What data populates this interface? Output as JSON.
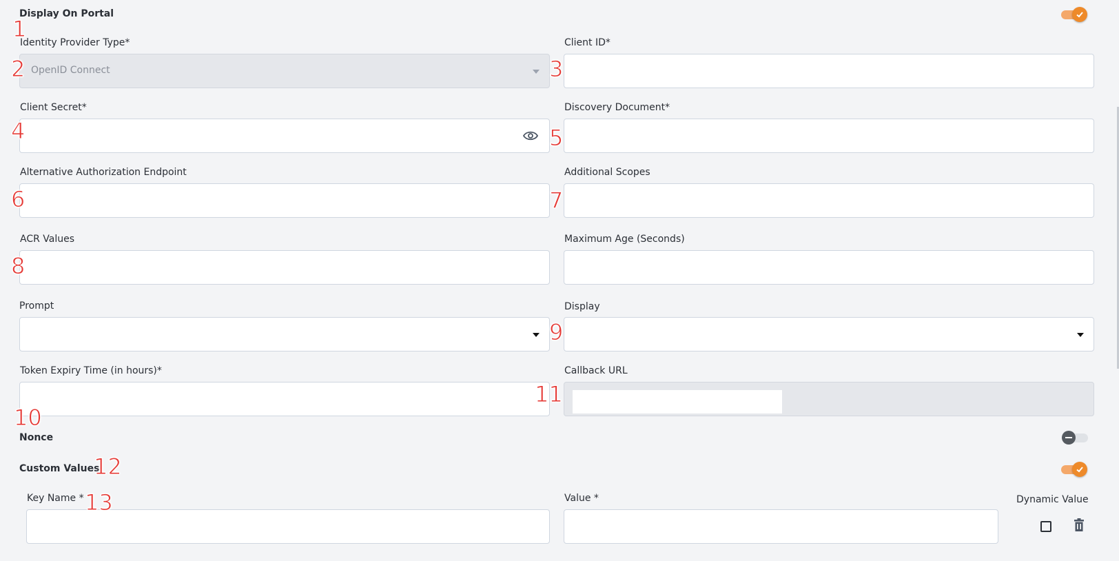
{
  "display_on_portal": {
    "label": "Display On Portal",
    "enabled": true
  },
  "fields": {
    "identity_provider_type": {
      "label": "Identity Provider Type*",
      "value": "OpenID Connect"
    },
    "client_id": {
      "label": "Client ID*",
      "value": ""
    },
    "client_secret": {
      "label": "Client Secret*",
      "value": ""
    },
    "discovery_document": {
      "label": "Discovery Document*",
      "value": ""
    },
    "alt_auth_endpoint": {
      "label": "Alternative Authorization Endpoint",
      "value": ""
    },
    "additional_scopes": {
      "label": "Additional Scopes",
      "value": ""
    },
    "acr_values": {
      "label": "ACR Values",
      "value": ""
    },
    "max_age": {
      "label": "Maximum Age (Seconds)",
      "value": ""
    },
    "prompt": {
      "label": "Prompt",
      "value": ""
    },
    "display": {
      "label": "Display",
      "value": ""
    },
    "token_expiry": {
      "label": "Token Expiry Time (in hours)*",
      "value": ""
    },
    "callback_url": {
      "label": "Callback URL",
      "value": ""
    }
  },
  "nonce": {
    "label": "Nonce",
    "enabled": false
  },
  "custom_values": {
    "label": "Custom Values",
    "enabled": true,
    "key_name_label": "Key Name *",
    "value_label": "Value *",
    "dynamic_value_label": "Dynamic Value",
    "key_name": "",
    "value": "",
    "dynamic": false
  },
  "annotations": [
    "1",
    "2",
    "3",
    "4",
    "5",
    "6",
    "7",
    "8",
    "9",
    "10",
    "11",
    "12",
    "13"
  ],
  "colors": {
    "accent": "#ee8a2a",
    "marker": "#e53935"
  }
}
